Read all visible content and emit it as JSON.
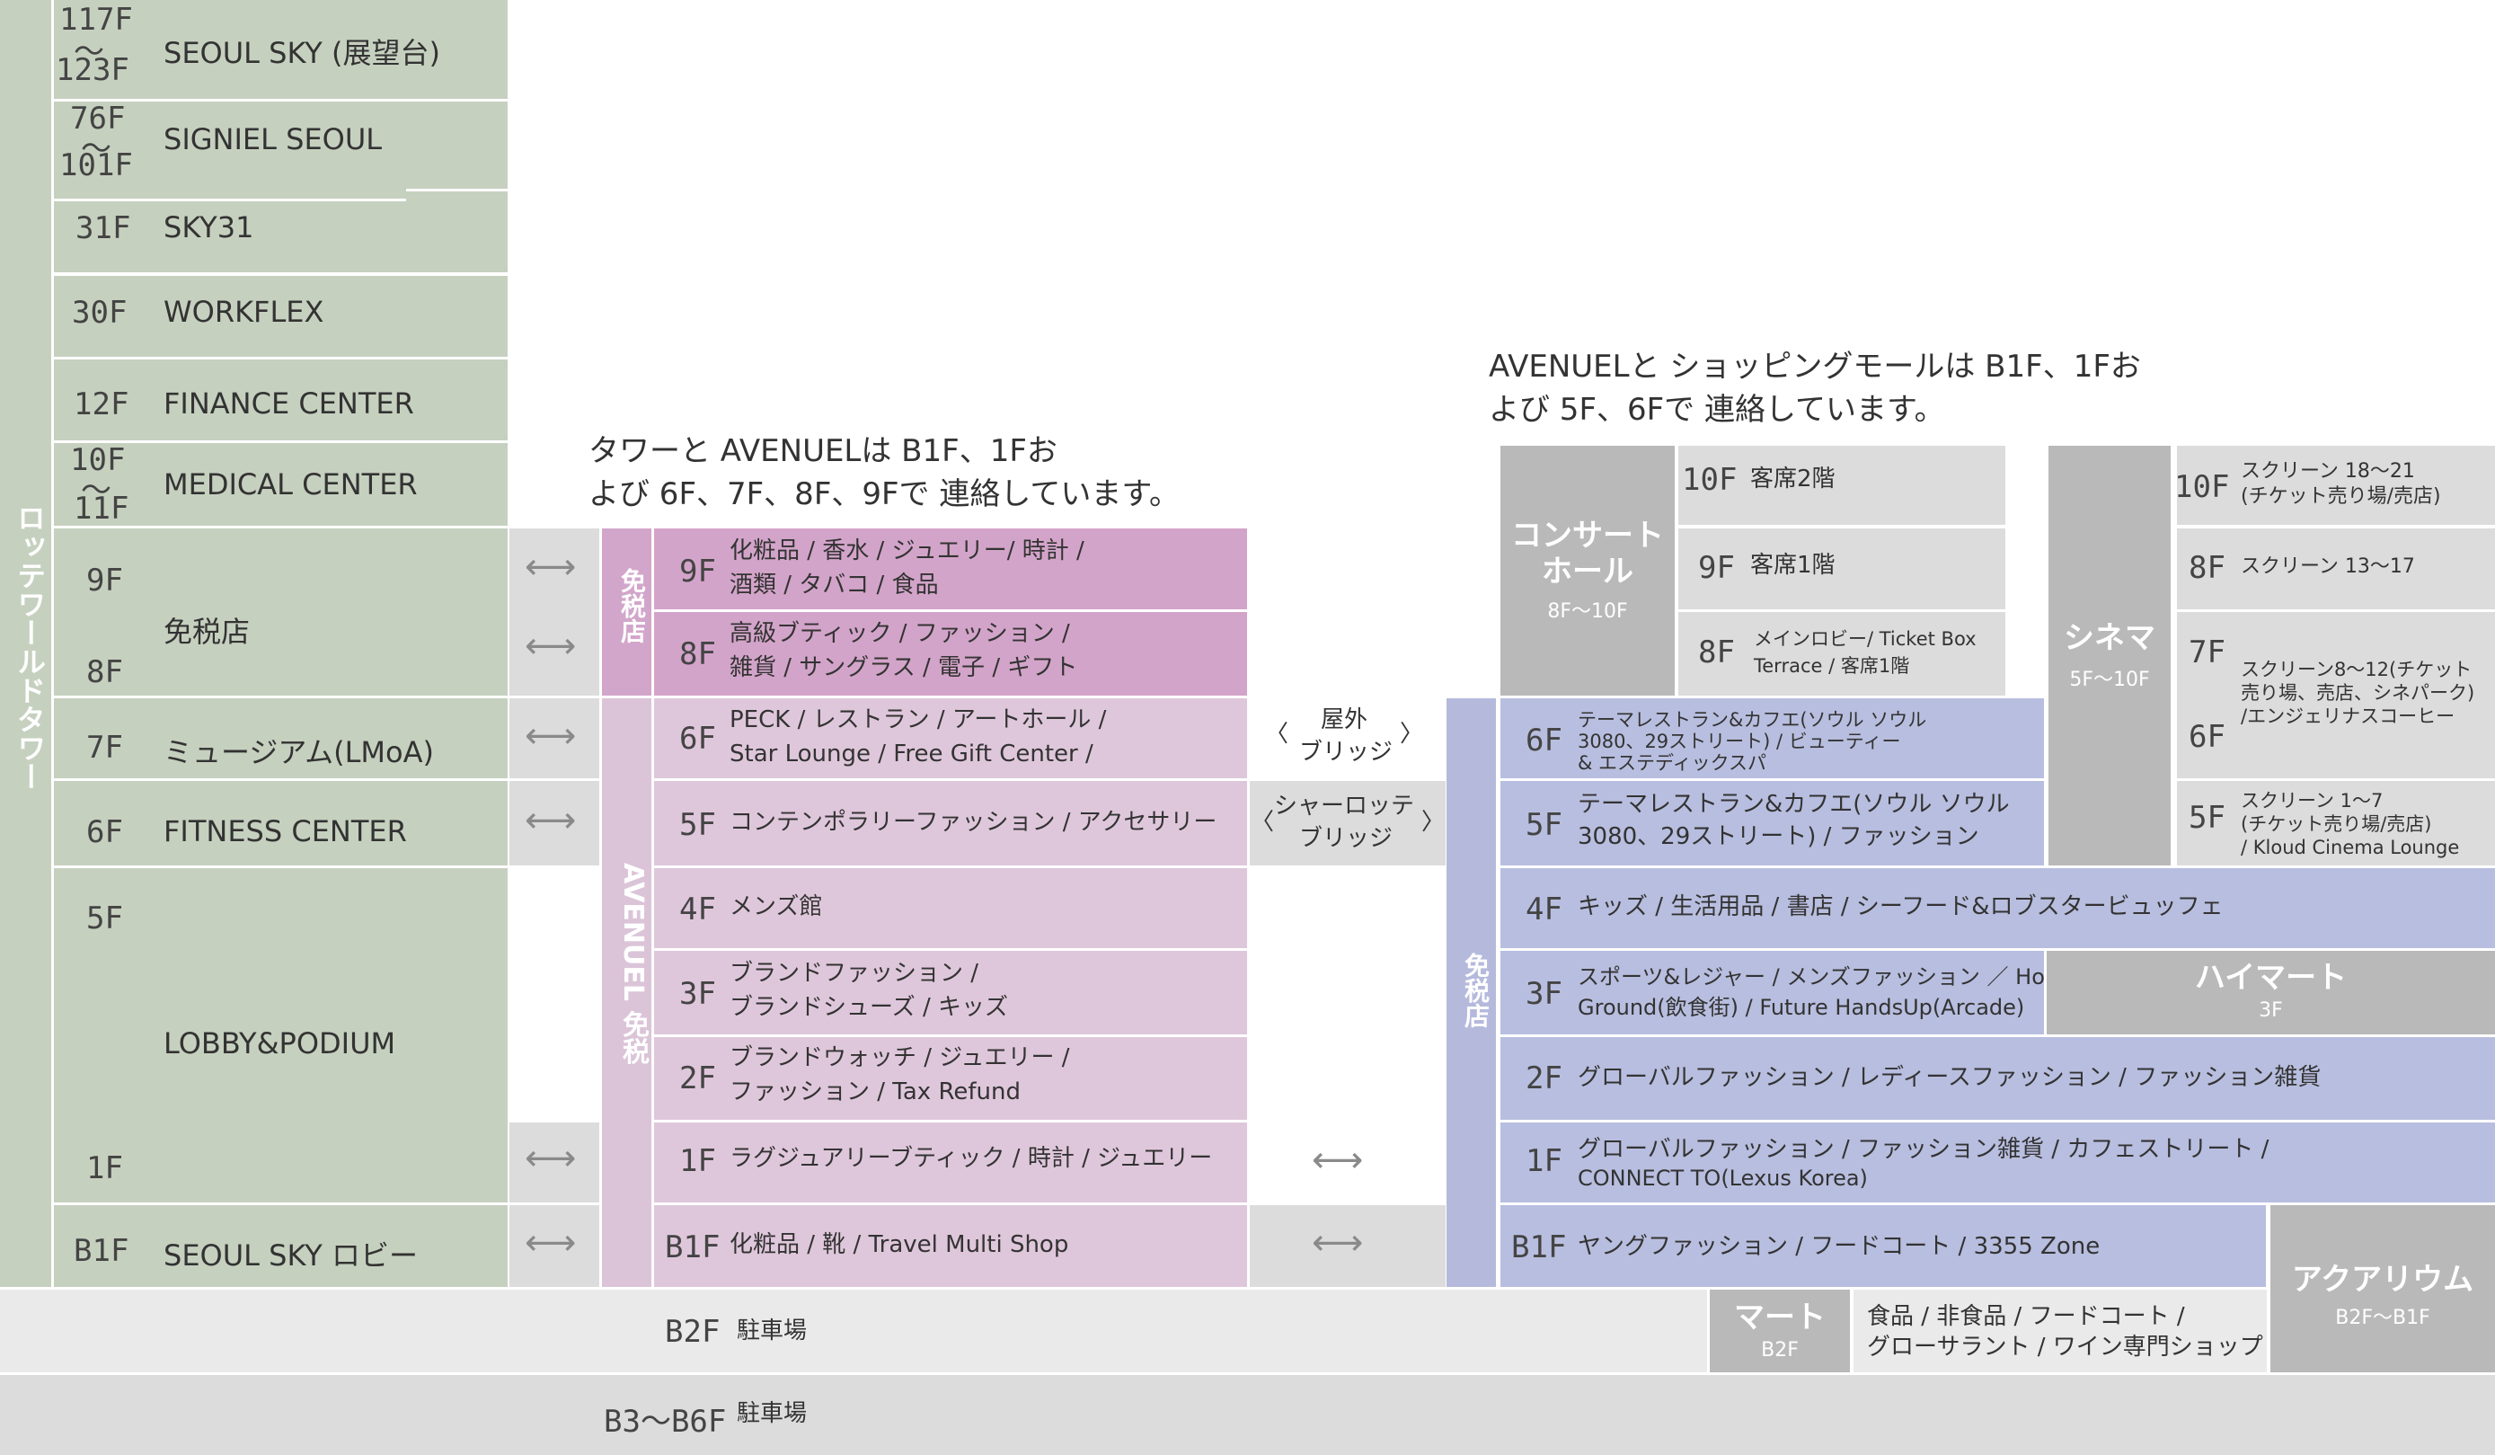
{
  "tower": {
    "title": "ロッテワールドタワー",
    "floors": [
      {
        "floor_top": "117F",
        "tilde": "〜",
        "floor_bottom": "123F",
        "name": "SEOUL SKY (展望台)"
      },
      {
        "floor_top": "76F",
        "tilde": "〜",
        "floor_bottom": "101F",
        "name": "SIGNIEL SEOUL"
      },
      {
        "floor": "31F",
        "name": "SKY31"
      },
      {
        "floor": "30F",
        "name": "WORKFLEX"
      },
      {
        "floor": "12F",
        "name": "FINANCE CENTER"
      },
      {
        "floor_top": "10F",
        "tilde": "〜",
        "floor_bottom": "11F",
        "name": "MEDICAL CENTER"
      },
      {
        "floor_a": "9F",
        "floor_b": "8F",
        "name": "免税店"
      },
      {
        "floor": "7F",
        "name": "ミュージアム(LMoA)"
      },
      {
        "floor": "6F",
        "name": "FITNESS CENTER"
      },
      {
        "floor_a": "5F",
        "floor_b": "1F",
        "name": "LOBBY&PODIUM"
      },
      {
        "floor": "B1F",
        "name": "SEOUL SKY ロビー"
      }
    ]
  },
  "notes": {
    "tower_avenuel": [
      "タワーと AVENUELは B1F、1Fお",
      "よび 6F、7F、8F、9Fで 連絡しています。"
    ],
    "avenuel_mall": [
      "AVENUELと ショッピングモールは B1F、1Fお",
      "よび 5F、6Fで 連絡しています。"
    ]
  },
  "avenuel": {
    "dutyfree_label": "免税店",
    "main_label": "AVENUEL 免税",
    "rows": [
      {
        "floor": "9F",
        "lines": [
          "化粧品 / 香水 / ジュエリー/ 時計 /",
          "酒類 / タバコ / 食品"
        ]
      },
      {
        "floor": "8F",
        "lines": [
          "高級ブティック / ファッション /",
          "雑貨 / サングラス / 電子 / ギフト"
        ]
      },
      {
        "floor": "6F",
        "lines": [
          "PECK / レストラン / アートホール /",
          "Star Lounge / Free Gift Center /"
        ]
      },
      {
        "floor": "5F",
        "lines": [
          "コンテンポラリーファッション / アクセサリー"
        ]
      },
      {
        "floor": "4F",
        "lines": [
          "メンズ館"
        ]
      },
      {
        "floor": "3F",
        "lines": [
          "ブランドファッション /",
          "ブランドシューズ / キッズ"
        ]
      },
      {
        "floor": "2F",
        "lines": [
          "ブランドウォッチ / ジュエリー /",
          "ファッション / Tax Refund"
        ]
      },
      {
        "floor": "1F",
        "lines": [
          "ラグジュアリーブティック / 時計 / ジュエリー"
        ]
      },
      {
        "floor": "B1F",
        "lines": [
          "化粧品 / 靴 / Travel Multi Shop"
        ]
      }
    ]
  },
  "bridges": {
    "outdoor": [
      "屋外",
      "ブリッジ"
    ],
    "charlotte": [
      "シャーロッテ",
      "ブリッジ"
    ],
    "left_bracket": "〈",
    "right_bracket": "〉"
  },
  "arrow_glyph": "⟷",
  "concert": {
    "title": [
      "コンサート",
      "ホール"
    ],
    "range": "8F〜10F",
    "rows": [
      {
        "floor": "10F",
        "lines": [
          "客席2階"
        ]
      },
      {
        "floor": "9F",
        "lines": [
          "客席1階"
        ]
      },
      {
        "floor": "8F",
        "lines": [
          "メインロビー/ Ticket Box",
          "Terrace / 客席1階"
        ]
      }
    ]
  },
  "cinema": {
    "title": "シネマ",
    "range": "5F〜10F",
    "rows": [
      {
        "floor": "10F",
        "lines": [
          "スクリーン 18〜21",
          "(チケット売り場/売店)"
        ]
      },
      {
        "floor": "8F",
        "lines": [
          "スクリーン 13〜17"
        ]
      },
      {
        "floor_a": "7F",
        "floor_b": "6F",
        "lines": [
          "スクリーン8〜12(チケット",
          "売り場、売店、シネパーク)",
          "/エンジェリナスコーヒー"
        ]
      },
      {
        "floor": "5F",
        "lines": [
          "スクリーン 1〜7",
          "(チケット売り場/売店)",
          "/ Kloud Cinema Lounge"
        ]
      }
    ]
  },
  "mall": {
    "dutyfree_label": "免税店",
    "rows": [
      {
        "floor": "6F",
        "lines": [
          "テーマレストラン&カフエ(ソウル ソウル",
          "3080、29ストリート) / ビューティー",
          "& エステディックスパ"
        ]
      },
      {
        "floor": "5F",
        "lines": [
          "テーマレストラン&カフエ(ソウル ソウル",
          "3080、29ストリート) / ファッション"
        ]
      },
      {
        "floor": "4F",
        "lines": [
          "キッズ / 生活用品 / 書店 / シーフード&ロブスタービュッフェ"
        ]
      },
      {
        "floor": "3F",
        "lines": [
          "スポーツ&レジャー / メンズファッション ／ Hong",
          "Ground(飲食街) / Future HandsUp(Arcade)"
        ]
      },
      {
        "floor": "2F",
        "lines": [
          "グローバルファッション / レディースファッション / ファッション雑貨"
        ]
      },
      {
        "floor": "1F",
        "lines": [
          "グローバルファッション / ファッション雑貨 / カフェストリート /",
          "CONNECT TO(Lexus Korea)"
        ]
      },
      {
        "floor": "B1F",
        "lines": [
          "ヤングファッション / フードコート /  3355 Zone"
        ]
      }
    ]
  },
  "himart": {
    "title": "ハイマート",
    "floor": "3F"
  },
  "aquarium": {
    "title": "アクアリウム",
    "range": "B2F〜B1F"
  },
  "mart": {
    "title": "マート",
    "floor": "B2F",
    "lines": [
      "食品 / 非食品 / フードコート /",
      "グローサラント / ワイン専門ショップ"
    ]
  },
  "basement": [
    {
      "floor": "B2F",
      "name": "駐車場"
    },
    {
      "floor": "B3〜B6F",
      "name": "駐車場"
    }
  ],
  "colors": {
    "tower": "#c6d0bf",
    "avenuel_dutyfree": "#d3a4c9",
    "avenuel": "#dfc7db",
    "mall": "#b8bedf",
    "concert_cinema": "#b9b9b9",
    "basement": "#dcdcdc"
  }
}
